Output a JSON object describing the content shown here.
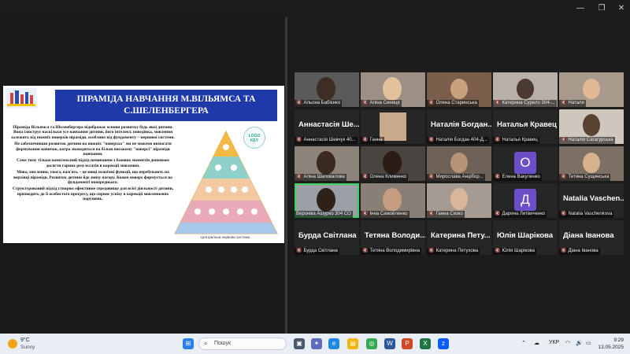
{
  "window": {
    "minimize_icon": "minimize-icon",
    "restore_icon": "restore-icon",
    "close_icon": "close-icon"
  },
  "slide": {
    "title": "ПІРАМІДА НАВЧАННЯ М.ВІЛЬЯМСА ТА С.ШЕЛЕНБЕРГЕРА",
    "paragraphs": [
      "Піраміда Вільямса та Шеленбергера відображає основи розвитку будь якої дитини. Вона ілюструє наскільки усе навчання дитини, його інтелект, поведінка, мовлення залежить від нижніх поверхів піраміди, особливо від фундаменту – нервової системи.",
      "Не забезпечивши розвиток дитини на нижніх \"поверхах\" ми не можемо вимагати формування навичок, котра знаходяться на більш високому \"поверсі\" піраміди навчання.",
      "Саме тому тільки комплексний підхід починаючи з базових моментів допоможе досягти гарних результатів в корекції мовлення.",
      "Мова, мислення, увага, пам'ять – це вищі психічні функції, що перебувають на верхівці піраміди. Розвиток дитини йде знизу нагору. Кожен поверх формується на фундаменті попереднього.",
      "Структурований підхід створює ефективне середовище для всієї діяльності дитини, призводить до її особистого прогресу, що сприяє успіху в корекції мовленнєвих порушень."
    ],
    "pyramid_caption": "Центральна нервова система",
    "logo_text": "LOGO KEY"
  },
  "participants": [
    {
      "label": "Альона Бабієнко",
      "big": "",
      "video": true,
      "muted": true
    },
    {
      "label": "Аліна Синиця",
      "big": "",
      "video": true,
      "muted": true
    },
    {
      "label": "Олена Старинська",
      "big": "",
      "video": true,
      "muted": true
    },
    {
      "label": "Катерина Сурело 304-...",
      "big": "",
      "video": true,
      "muted": true
    },
    {
      "label": "Наталя",
      "big": "",
      "video": true,
      "muted": true
    },
    {
      "label": "Аннастасія Шевчук 40...",
      "big": "Аннастасія Ше...",
      "video": false,
      "muted": true
    },
    {
      "label": "Ганна",
      "big": "",
      "video": true,
      "muted": true
    },
    {
      "label": "Наталія Богдан 404-Д...",
      "big": "Наталія Богдан...",
      "video": false,
      "muted": true
    },
    {
      "label": "Наталья Кравец",
      "big": "Наталья Кравец",
      "video": false,
      "muted": true
    },
    {
      "label": "Наталія Сагагурська",
      "big": "",
      "video": true,
      "muted": true
    },
    {
      "label": "Аліна Шаповалова",
      "big": "",
      "video": true,
      "muted": true
    },
    {
      "label": "Олена Клименко",
      "big": "",
      "video": true,
      "muted": true
    },
    {
      "label": "Мирослава Анцібор...",
      "big": "",
      "video": true,
      "muted": true
    },
    {
      "label": "Елена Вакуленко",
      "big": "",
      "video": false,
      "muted": true,
      "avatar": "O"
    },
    {
      "label": "Тетяна Сущинська",
      "big": "",
      "video": true,
      "muted": true
    },
    {
      "label": "Вероніка Ашурко 304 СО",
      "big": "",
      "video": true,
      "muted": false,
      "active": true
    },
    {
      "label": "Інна Самойленко",
      "big": "",
      "video": true,
      "muted": true
    },
    {
      "label": "Ганна Сизко",
      "big": "",
      "video": true,
      "muted": true
    },
    {
      "label": "Дарина Литвиченко",
      "big": "",
      "video": false,
      "muted": true,
      "avatar": "Д"
    },
    {
      "label": "Natalia Vaschenkova",
      "big": "Natalia Vaschen...",
      "video": false,
      "muted": true
    },
    {
      "label": "Бурда Світлана",
      "big": "Бурда Світлана",
      "video": false,
      "muted": true
    },
    {
      "label": "Тетяна Володимирівна",
      "big": "Тетяна Володи...",
      "video": false,
      "muted": true
    },
    {
      "label": "Катерина Петухова",
      "big": "Катерина Пету...",
      "video": false,
      "muted": true
    },
    {
      "label": "Юлія Шарікова",
      "big": "Юлія Шарікова",
      "video": false,
      "muted": true
    },
    {
      "label": "Діана Іванова",
      "big": "Діана Іванова",
      "video": false,
      "muted": true
    }
  ],
  "taskbar": {
    "weather_temp": "9°C",
    "weather_desc": "Sunny",
    "search_label": "Пошук",
    "language": "УКР",
    "time": "9:29",
    "date": "13.05.2025"
  }
}
